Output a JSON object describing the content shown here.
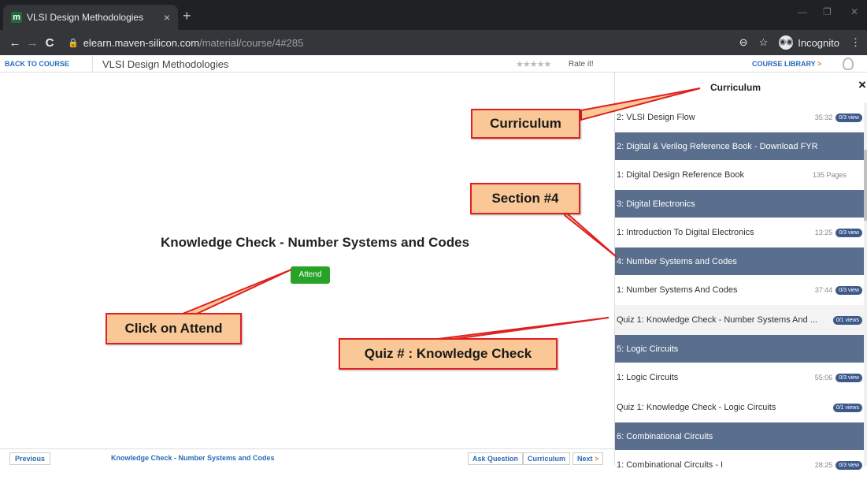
{
  "browser": {
    "tab_title": "VLSI Design Methodologies",
    "tab_close": "×",
    "new_tab": "+",
    "url_host": "elearn.maven-silicon.com",
    "url_path": "/material/course/4#285",
    "incognito_label": "Incognito",
    "nav_back": "←",
    "nav_forward": "→",
    "nav_reload": "C",
    "zoom_icon": "⊖",
    "star_icon": "☆",
    "menu_icon": "⋮"
  },
  "subbar": {
    "back_label": "BACK TO COURSE",
    "course_title": "VLSI Design Methodologies",
    "stars": "★★★★★",
    "rate_label": "Rate it!",
    "library_label": "COURSE LIBRARY",
    "library_arrow": ">"
  },
  "main": {
    "heading": "Knowledge Check - Number Systems and Codes",
    "attend_label": "Attend"
  },
  "curriculum": {
    "title": "Curriculum",
    "close": "×",
    "rows": [
      {
        "type": "item",
        "text": "2: VLSI Design Flow",
        "duration": "35:32",
        "badge": "0/3 view"
      },
      {
        "type": "header",
        "text": "2: Digital & Verilog Reference Book - Download FYR"
      },
      {
        "type": "item",
        "text": "1: Digital Design Reference Book",
        "pages": "135 Pages"
      },
      {
        "type": "header",
        "text": "3: Digital Electronics"
      },
      {
        "type": "item",
        "text": "1: Introduction To Digital Electronics",
        "duration": "13:25",
        "badge": "0/3 view"
      },
      {
        "type": "header",
        "text": "4: Number Systems and Codes"
      },
      {
        "type": "item",
        "text": "1: Number Systems And Codes",
        "duration": "37:44",
        "badge": "0/3 view"
      },
      {
        "type": "item",
        "shade": true,
        "text": "Quiz 1: Knowledge Check - Number Systems And ...",
        "badge": "0/1 views"
      },
      {
        "type": "header",
        "text": "5: Logic Circuits"
      },
      {
        "type": "item",
        "text": "1: Logic Circuits",
        "duration": "55:06",
        "badge": "0/3 view"
      },
      {
        "type": "item",
        "text": "Quiz 1: Knowledge Check - Logic Circuits",
        "badge": "0/1 views"
      },
      {
        "type": "header",
        "text": "6: Combinational Circuits"
      },
      {
        "type": "item",
        "text": "1: Combinational Circuits - I",
        "duration": "28:25",
        "badge": "0/3 view"
      }
    ]
  },
  "footer": {
    "previous_label": "Previous",
    "title": "Knowledge Check - Number Systems and Codes",
    "ask_label": "Ask Question",
    "curriculum_label": "Curriculum",
    "next_label": "Next",
    "next_arrow": ">"
  },
  "callouts": {
    "curriculum": "Curriculum",
    "section": "Section #4",
    "attend": "Click on Attend",
    "quiz": "Quiz # : Knowledge Check"
  },
  "colors": {
    "section_header": "#5a6e8e",
    "attend_button": "#27a428",
    "callout_fill": "#f9c896",
    "callout_border": "#e02020"
  }
}
